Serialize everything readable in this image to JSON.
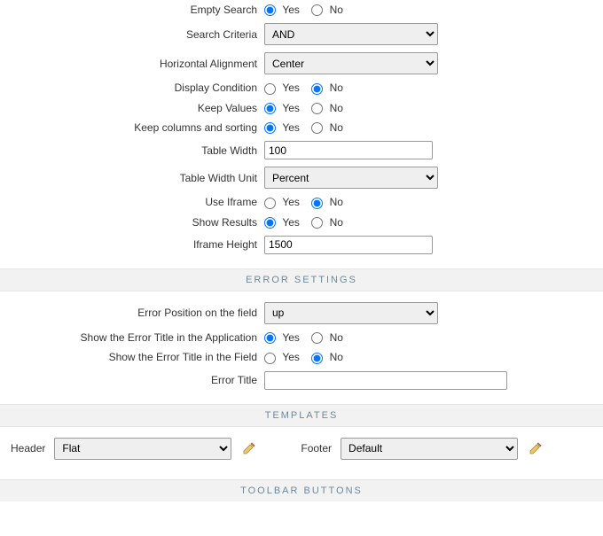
{
  "labels": {
    "empty_search": "Empty Search",
    "search_criteria": "Search Criteria",
    "horizontal_alignment": "Horizontal Alignment",
    "display_condition": "Display Condition",
    "keep_values": "Keep Values",
    "keep_columns_sorting": "Keep columns and sorting",
    "table_width": "Table Width",
    "table_width_unit": "Table Width Unit",
    "use_iframe": "Use Iframe",
    "show_results": "Show Results",
    "iframe_height": "Iframe Height",
    "error_position": "Error Position on the field",
    "show_error_title_app": "Show the Error Title in the Application",
    "show_error_title_field": "Show the Error Title in the Field",
    "error_title": "Error Title",
    "header": "Header",
    "footer": "Footer"
  },
  "radio": {
    "yes": "Yes",
    "no": "No"
  },
  "values": {
    "empty_search": "yes",
    "search_criteria": "AND",
    "horizontal_alignment": "Center",
    "display_condition": "no",
    "keep_values": "yes",
    "keep_columns_sorting": "yes",
    "table_width": "100",
    "table_width_unit": "Percent",
    "use_iframe": "no",
    "show_results": "yes",
    "iframe_height": "1500",
    "error_position": "up",
    "show_error_title_app": "yes",
    "show_error_title_field": "no",
    "error_title": "",
    "header_template": "Flat",
    "footer_template": "Default"
  },
  "sections": {
    "error_settings": "ERROR SETTINGS",
    "templates": "TEMPLATES",
    "toolbar_buttons": "TOOLBAR BUTTONS"
  }
}
